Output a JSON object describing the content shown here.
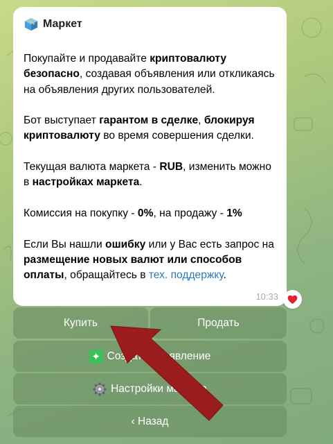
{
  "bot": {
    "title": "Маркет",
    "icon": "package-icon"
  },
  "message": {
    "p1": {
      "t1": "Покупайте и продавайте ",
      "b1": "криптовалюту безопасно",
      "t2": ", создавая объявления или откликаясь на объявления других пользователей."
    },
    "p2": {
      "t1": "Бот выступает ",
      "b1": "гарантом в сделке",
      "t2": ", ",
      "b2": "блокируя криптовалюту",
      "t3": " во время совершения сделки."
    },
    "p3": {
      "t1": "Текущая валюта маркета - ",
      "b1": "RUB",
      "t2": ", изменить можно в ",
      "b2": "настройках маркета",
      "t3": "."
    },
    "p4": {
      "t1": "Комиссия на покупку - ",
      "b1": "0%",
      "t2": ", на продажу - ",
      "b2": "1%"
    },
    "p5": {
      "t1": "Если Вы нашли ",
      "b1": "ошибку",
      "t2": " или у Вас есть запрос на ",
      "b2": "размещение новых валют или способов оплаты",
      "t3": ", обращайтесь в ",
      "link": "тех. поддержку",
      "t4": "."
    },
    "time": "10:33",
    "reaction": "heart-icon"
  },
  "buttons": {
    "buy": "Купить",
    "sell": "Продать",
    "create": "Создать объявление",
    "settings": "Настройки маркета",
    "back": "‹ Назад"
  },
  "colors": {
    "link": "#2a7ac0",
    "button_bg": "#7d9a6e",
    "annotation_arrow": "#9b1c1c",
    "heart": "#e0242f"
  }
}
